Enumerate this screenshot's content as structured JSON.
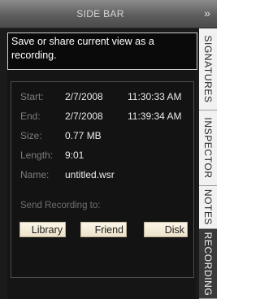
{
  "window": {
    "title": "SIDE BAR",
    "collapse_glyph": "»"
  },
  "panel": {
    "description": "Save or share current view as a recording.",
    "fields": {
      "start": {
        "label": "Start:",
        "date": "2/7/2008",
        "time": "11:30:33 AM"
      },
      "end": {
        "label": "End:",
        "date": "2/7/2008",
        "time": "11:39:34 AM"
      },
      "size": {
        "label": "Size:",
        "value": "0.77 MB"
      },
      "length": {
        "label": "Length:",
        "value": "9:01"
      },
      "name": {
        "label": "Name:",
        "value": "untitled.wsr"
      }
    },
    "send_label": "Send Recording to:",
    "buttons": {
      "library": "Library",
      "friend": "Friend",
      "disk": "Disk"
    }
  },
  "tabs": [
    {
      "label": "SIGNATURES",
      "active": false
    },
    {
      "label": "INSPECTOR",
      "active": false
    },
    {
      "label": "NOTES",
      "active": false
    },
    {
      "label": "RECORDING",
      "active": true
    }
  ],
  "colors": {
    "active_tab": "#3a3a3a",
    "inactive_tab": "#f1f1f1",
    "button": "#f5eedc"
  },
  "icons": {
    "collapse": "double-chevron-right-icon"
  }
}
